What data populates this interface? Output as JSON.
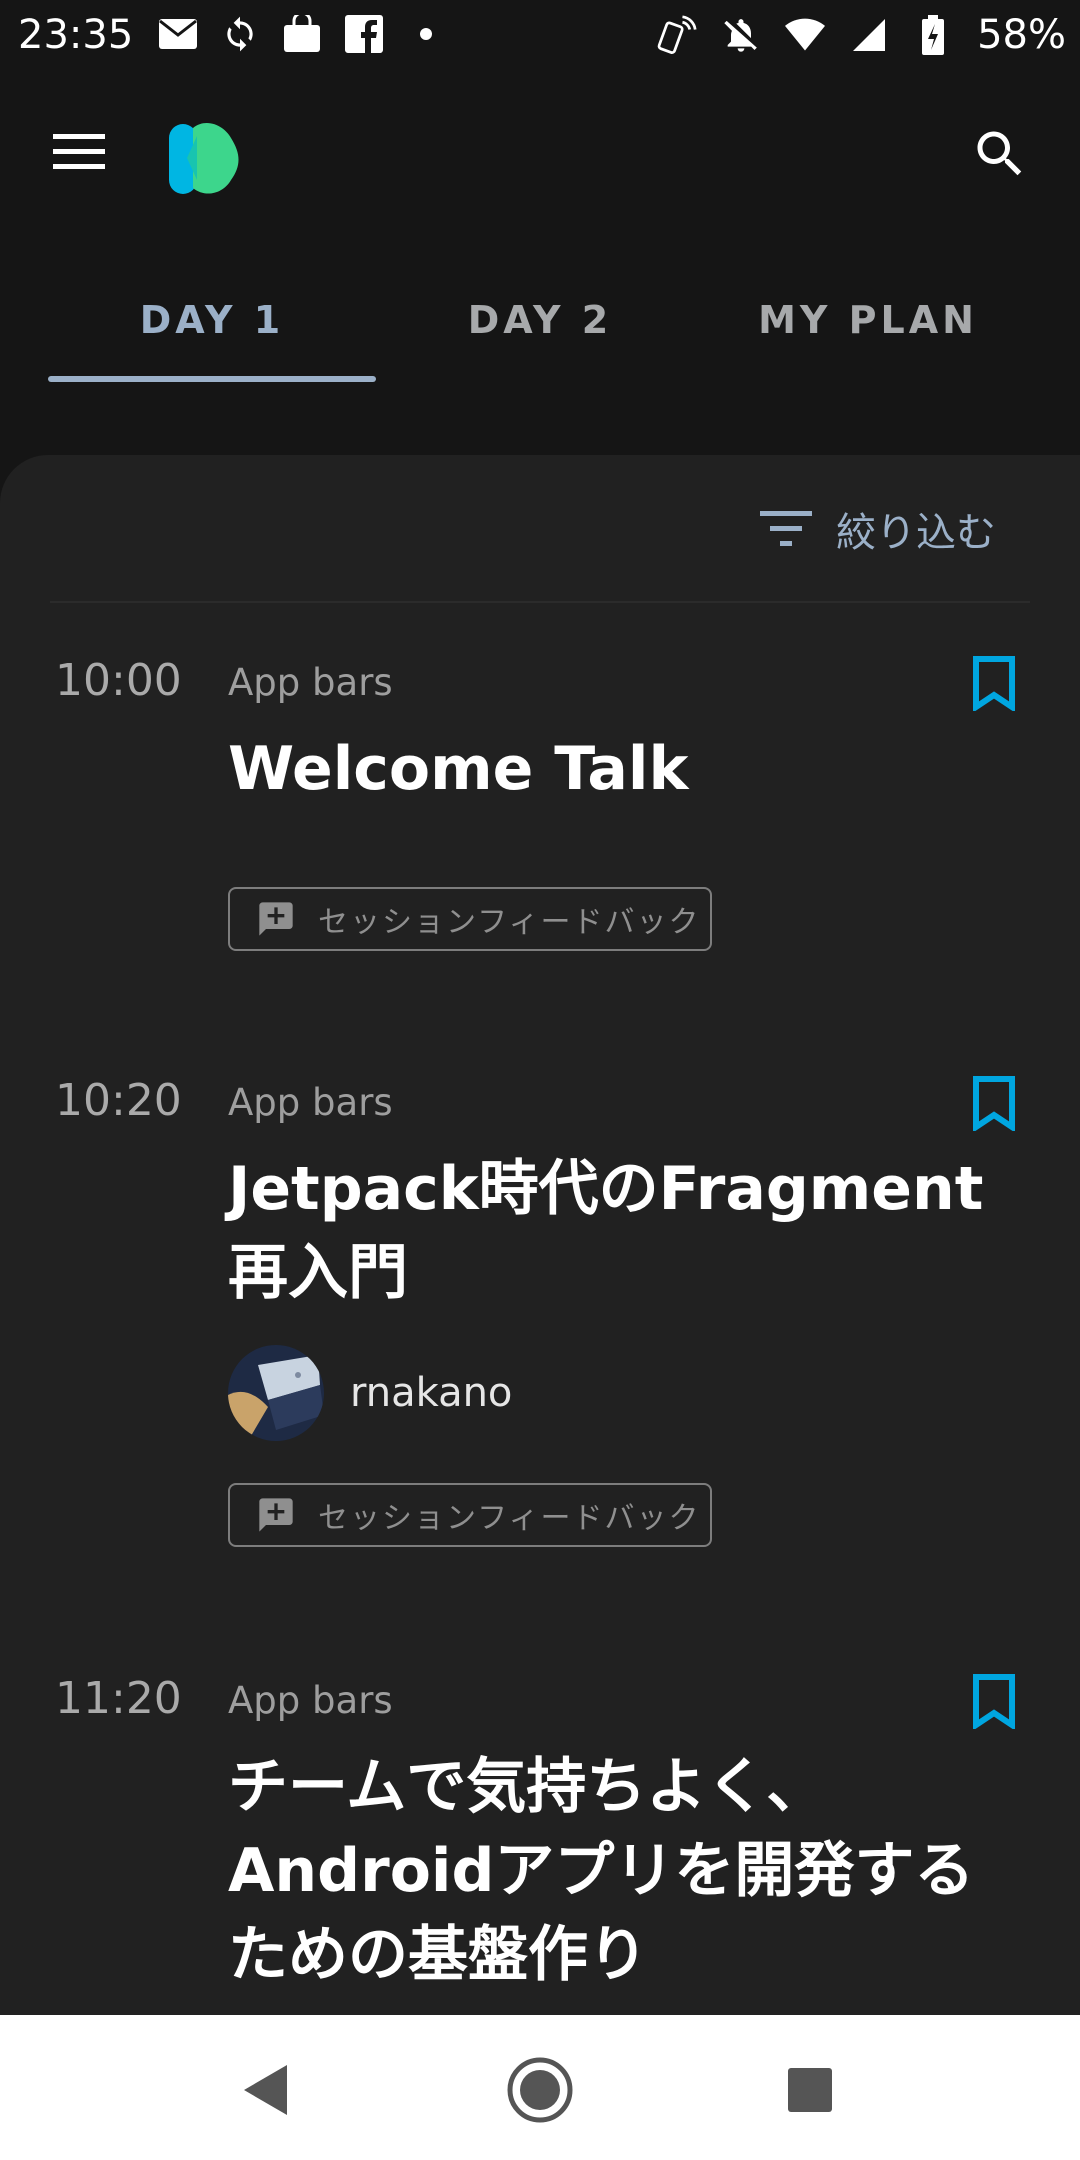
{
  "status_bar": {
    "time": "23:35",
    "battery": "58%",
    "left_icons": [
      "au-mail-icon",
      "sync-icon",
      "market-icon",
      "facebook-icon",
      "dot-icon"
    ],
    "right_icons": [
      "nfc-icon",
      "mute-icon",
      "wifi-icon",
      "signal-icon",
      "battery-icon"
    ]
  },
  "app_bar": {
    "logo": "droidkaigi-logo"
  },
  "tabs": [
    {
      "label": "DAY 1",
      "active": true
    },
    {
      "label": "DAY 2",
      "active": false
    },
    {
      "label": "MY PLAN",
      "active": false
    }
  ],
  "filter": {
    "label": "絞り込む"
  },
  "sessions": [
    {
      "time": "10:00",
      "room": "App bars",
      "title": "Welcome Talk",
      "feedback": "セッションフィードバック"
    },
    {
      "time": "10:20",
      "room": "App bars",
      "title_line1": "Jetpack時代のFragment",
      "title_line2": "再入門",
      "speaker": "rnakano",
      "feedback": "セッションフィードバック"
    },
    {
      "time": "11:20",
      "room": "App bars",
      "title_line1": "チームで気持ちよく、",
      "title_line2": "Androidアプリを開発する",
      "title_line3": "ための基盤作り"
    }
  ],
  "colors": {
    "accent": "#00a6e0",
    "tab_active": "#9bb0c8",
    "background": "#151515",
    "sheet": "#212121"
  }
}
